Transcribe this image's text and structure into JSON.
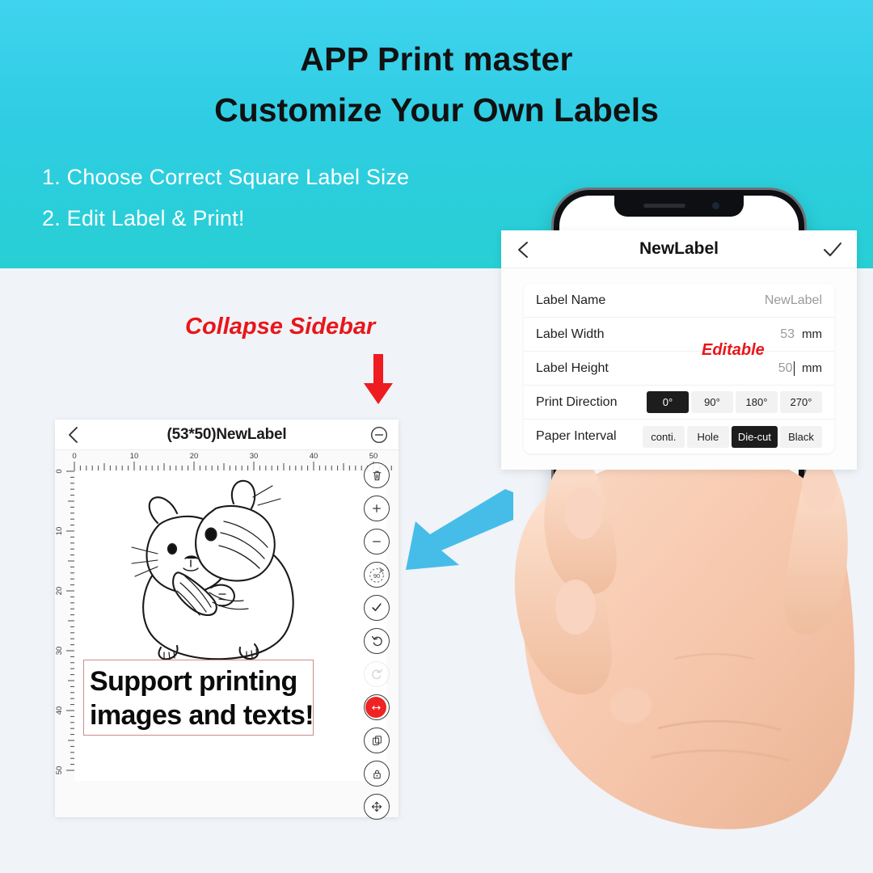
{
  "hero": {
    "title_line1": "APP Print master",
    "title_line2": "Customize Your Own Labels",
    "step1": "1. Choose Correct Square Label Size",
    "step2": "2. Edit Label & Print!",
    "bg_color_top": "#3fd3ee",
    "bg_color_bottom": "#27cfd3",
    "text_color": "#111111",
    "step_text_color": "#ffffff"
  },
  "annotations": {
    "collapse_sidebar": "Collapse Sidebar",
    "editable": "Editable",
    "annotation_color": "#e8161b",
    "arrow_down_icon": "arrow-down-icon",
    "blue_arrow_icon": "arrow-down-left-icon",
    "blue_arrow_color": "#45bde8"
  },
  "editor": {
    "back_icon": "chevron-left-icon",
    "title": "(53*50)NewLabel",
    "collapse_icon": "minus-circle-icon",
    "ruler_h_ticks": [
      "0",
      "10",
      "20",
      "30",
      "40",
      "50"
    ],
    "ruler_v_ticks": [
      "0",
      "10",
      "20",
      "30",
      "40",
      "50"
    ],
    "canvas_image": "hamster-line-drawing",
    "text_object": {
      "line1": "Support printing",
      "line2": "images and texts!",
      "border_color": "#d08a8a"
    },
    "tools": [
      {
        "name": "delete-icon",
        "label": "Delete"
      },
      {
        "name": "zoom-in-icon",
        "label": "Zoom In"
      },
      {
        "name": "zoom-out-icon",
        "label": "Zoom Out"
      },
      {
        "name": "rotate-90-icon",
        "label": "90"
      },
      {
        "name": "confirm-icon",
        "label": "Confirm"
      },
      {
        "name": "undo-icon",
        "label": "Undo"
      },
      {
        "name": "redo-icon",
        "label": "Redo"
      },
      {
        "name": "align-text-icon",
        "label": "Align"
      },
      {
        "name": "duplicate-icon",
        "label": "Duplicate"
      },
      {
        "name": "lock-icon",
        "label": "Lock"
      },
      {
        "name": "move-icon",
        "label": "Move"
      }
    ],
    "drag_handle_icon": "resize-handle-icon",
    "drag_handle_color": "#ef2323"
  },
  "settings": {
    "back_icon": "chevron-left-icon",
    "title": "NewLabel",
    "confirm_icon": "check-icon",
    "rows": [
      {
        "label": "Label Name",
        "value": "NewLabel",
        "unit": ""
      },
      {
        "label": "Label Width",
        "value": "53",
        "unit": "mm"
      },
      {
        "label": "Label Height",
        "value": "50",
        "unit": "mm"
      }
    ],
    "print_direction": {
      "label": "Print Direction",
      "options": [
        "0°",
        "90°",
        "180°",
        "270°"
      ],
      "selected": "0°"
    },
    "paper_interval": {
      "label": "Paper Interval",
      "options": [
        "conti.",
        "Hole",
        "Die-cut",
        "Black"
      ],
      "selected": "Die-cut"
    }
  },
  "phone": {
    "notch_speaker_icon": "speaker-grill-icon",
    "notch_camera_icon": "front-camera-icon",
    "hand_image": "hand-holding-phone"
  }
}
